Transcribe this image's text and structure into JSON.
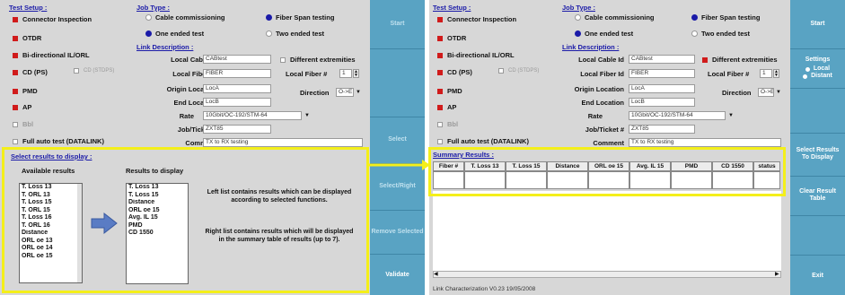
{
  "left": {
    "test_setup": {
      "title": "Test Setup :",
      "items": [
        {
          "label": "Connector Inspection"
        },
        {
          "label": "OTDR"
        },
        {
          "label": "Bi-directional IL/ORL"
        },
        {
          "label": "CD (PS)"
        },
        {
          "label": "PMD"
        },
        {
          "label": "AP"
        },
        {
          "label": "Bbl"
        },
        {
          "label": "Full auto test (DATALINK)"
        }
      ],
      "cd_extra": "CD (STDPS)"
    },
    "job_type": {
      "title": "Job Type :",
      "options": [
        "Cable commissioning",
        "Fiber Span testing",
        "One ended test",
        "Two ended test"
      ]
    },
    "link": {
      "title": "Link Description :",
      "local_cable_label": "Local Cable Id",
      "local_cable_value": "CABtest",
      "local_fiber_label": "Local Fiber Id",
      "local_fiber_value": "FIBER",
      "origin_label": "Origin Location",
      "origin_value": "LocA",
      "end_label": "End Location",
      "end_value": "LocB",
      "rate_label": "Rate",
      "rate_value": "10Gbit/OC-192/STM-64",
      "job_label": "Job/Ticket #",
      "job_value": "ZXT85",
      "comment_label": "Comment",
      "comment_value": "TX to RX testing",
      "diff_label": "Different extremities",
      "fiber_num_label": "Local Fiber #",
      "fiber_num_value": "1",
      "direction_label": "Direction",
      "direction_value": "O->E"
    },
    "select": {
      "title": "Select results to display :",
      "available_title": "Available results",
      "available": [
        "T. Loss 13",
        "T. ORL 13",
        "T. Loss 15",
        "T. ORL 15",
        "T. Loss 16",
        "T. ORL 16",
        "Distance",
        "ORL oe 13",
        "ORL oe 14",
        "ORL oe 15"
      ],
      "display_title": "Results to display",
      "display": [
        "T. Loss 13",
        "T. Loss 15",
        "Distance",
        "ORL oe 15",
        "Avg. IL 15",
        "PMD",
        "CD 1550"
      ],
      "desc1": "Left list contains results which can be displayed according to selected functions.",
      "desc2": "Right list contains results which will be displayed in the summary table of results (up to 7)."
    },
    "side": {
      "b1": "Start",
      "b2": "Select",
      "b3": "Select/Right",
      "b4": "Remove Selected",
      "b5": "Validate"
    }
  },
  "right": {
    "test_setup": {
      "title": "Test Setup :",
      "items": [
        {
          "label": "Connector Inspection"
        },
        {
          "label": "OTDR"
        },
        {
          "label": "Bi-directional IL/ORL"
        },
        {
          "label": "CD (PS)"
        },
        {
          "label": "PMD"
        },
        {
          "label": "AP"
        },
        {
          "label": "Bbl"
        },
        {
          "label": "Full auto test (DATALINK)"
        }
      ],
      "cd_extra": "CD (STDPS)"
    },
    "job_type": {
      "title": "Job Type :",
      "options": [
        "Cable commissioning",
        "Fiber Span testing",
        "One ended test",
        "Two ended test"
      ]
    },
    "link": {
      "title": "Link Description :",
      "local_cable_label": "Local Cable Id",
      "local_cable_value": "CABtest",
      "local_fiber_label": "Local Fiber Id",
      "local_fiber_value": "FIBER",
      "origin_label": "Origin Location",
      "origin_value": "LocA",
      "end_label": "End Location",
      "end_value": "LocB",
      "rate_label": "Rate",
      "rate_value": "10Gbit/OC-192/STM-64",
      "job_label": "Job/Ticket #",
      "job_value": "ZXT85",
      "comment_label": "Comment",
      "comment_value": "TX to RX testing",
      "diff_label": "Different extremities",
      "fiber_num_label": "Local Fiber #",
      "fiber_num_value": "1",
      "direction_label": "Direction",
      "direction_value": "O->E"
    },
    "summary": {
      "title": "Summary Results :",
      "headers": [
        "Fiber #",
        "T. Loss 13",
        "T. Loss 15",
        "Distance",
        "ORL oe 15",
        "Avg. IL 15",
        "PMD",
        "CD 1550",
        "status"
      ]
    },
    "status_bar": "Link Characterization V0.23 19/05/2008",
    "side": {
      "start": "Start",
      "settings": "Settings",
      "local": "Local",
      "distant": "Distant",
      "select": "Select Results To Display",
      "clear": "Clear Result Table",
      "exit": "Exit"
    }
  },
  "colors": {
    "highlight": "#f4ef1a",
    "side_panel": "#59a3c3",
    "title_blue": "#1b1ba8",
    "checked_red": "#d01b1b"
  }
}
